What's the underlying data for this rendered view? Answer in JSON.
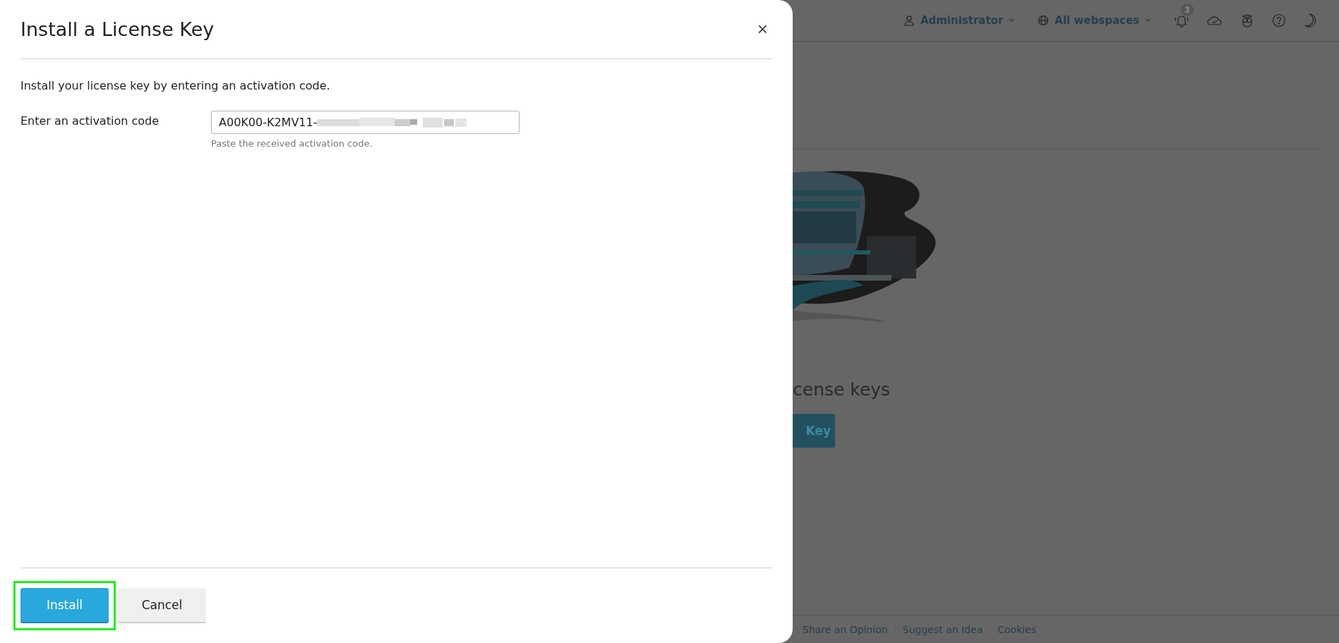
{
  "dialog": {
    "title": "Install a License Key",
    "close": "×",
    "description": "Install your license key by entering an activation code.",
    "field": {
      "label": "Enter an activation code",
      "value": "A00K00-K2MV11-",
      "redacted": true,
      "hint": "Paste the received activation code."
    },
    "buttons": [
      {
        "label": "Install",
        "kind": "primary",
        "highlighted": true
      },
      {
        "label": "Cancel",
        "kind": "secondary",
        "highlighted": false
      }
    ]
  },
  "topbar": {
    "user": "Administrator",
    "webspaces": "All webspaces",
    "notifications": "3"
  },
  "page": {
    "heading": "cense keys",
    "button": "Key"
  },
  "footer": {
    "links": [
      "Share an Opinion",
      "Suggest an Idea",
      "Cookies"
    ]
  }
}
